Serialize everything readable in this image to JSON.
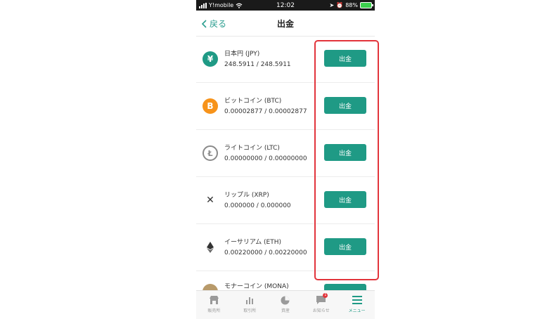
{
  "status_bar": {
    "carrier": "Y!mobile",
    "time": "12:02",
    "battery": "88%"
  },
  "nav": {
    "back_label": "戻る",
    "title": "出金"
  },
  "coins": [
    {
      "name": "日本円 (JPY)",
      "balance": "248.5911 / 248.5911",
      "icon": "yen-icon",
      "symbol": "¥",
      "color": "#1f9a85",
      "button": "出金"
    },
    {
      "name": "ビットコイン (BTC)",
      "balance": "0.00002877 / 0.00002877",
      "icon": "bitcoin-icon",
      "symbol": "B",
      "color": "#f7931a",
      "button": "出金"
    },
    {
      "name": "ライトコイン (LTC)",
      "balance": "0.00000000 / 0.00000000",
      "icon": "litecoin-icon",
      "symbol": "Ł",
      "color": "#8a8a8a",
      "button": "出金"
    },
    {
      "name": "リップル (XRP)",
      "balance": "0.000000 / 0.000000",
      "icon": "ripple-icon",
      "symbol": "✕",
      "color": "#333333",
      "button": "出金"
    },
    {
      "name": "イーサリアム (ETH)",
      "balance": "0.00220000 / 0.00220000",
      "icon": "ethereum-icon",
      "symbol": "◆",
      "color": "#333333",
      "button": "出金"
    },
    {
      "name": "モナーコイン (MONA)",
      "balance": "",
      "icon": "monacoin-icon",
      "symbol": "",
      "color": "#b89a6a",
      "button": ""
    }
  ],
  "tabs": [
    {
      "label": "販売所",
      "icon": "store-icon",
      "active": false
    },
    {
      "label": "取引所",
      "icon": "chart-icon",
      "active": false
    },
    {
      "label": "資産",
      "icon": "pie-chart-icon",
      "active": false
    },
    {
      "label": "お知らせ",
      "icon": "message-icon",
      "active": false,
      "badge": "1"
    },
    {
      "label": "メニュー",
      "icon": "menu-icon",
      "active": true
    }
  ],
  "colors": {
    "accent": "#1f9a85",
    "highlight": "#e2343b"
  }
}
